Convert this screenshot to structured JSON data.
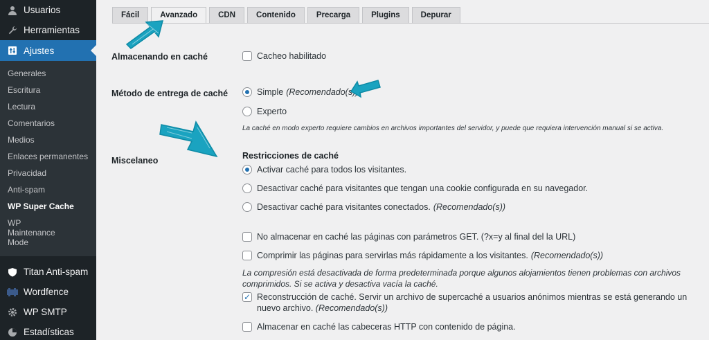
{
  "sidebar": {
    "top_items": [
      {
        "label": "Usuarios",
        "icon": "user-icon"
      },
      {
        "label": "Herramientas",
        "icon": "wrench-icon"
      }
    ],
    "active": {
      "label": "Ajustes",
      "icon": "settings-icon"
    },
    "submenu": [
      "Generales",
      "Escritura",
      "Lectura",
      "Comentarios",
      "Medios",
      "Enlaces permanentes",
      "Privacidad",
      "Anti-spam",
      "WP Super Cache",
      "WP Maintenance Mode"
    ],
    "bottom_items": [
      {
        "label": "Titan Anti-spam",
        "icon": "shield-icon"
      },
      {
        "label": "Wordfence",
        "icon": "wordfence-icon"
      },
      {
        "label": "WP SMTP",
        "icon": "gear-icon"
      },
      {
        "label": "Estadísticas",
        "icon": "pie-chart-icon"
      }
    ]
  },
  "tabs": [
    "Fácil",
    "Avanzado",
    "CDN",
    "Contenido",
    "Precarga",
    "Plugins",
    "Depurar"
  ],
  "settings": {
    "caching_label": "Almacenando en caché",
    "caching_option": "Cacheo habilitado",
    "delivery_label": "Método de entrega de caché",
    "delivery_simple": "Simple",
    "delivery_simple_note": "(Recomendado(s))",
    "delivery_expert": "Experto",
    "delivery_help": "La caché en modo experto requiere cambios en archivos importantes del servidor, y puede que requiera intervención manual si se activa.",
    "misc_label": "Miscelaneo",
    "restrictions_title": "Restricciones de caché",
    "restrict_all": "Activar caché para todos los visitantes.",
    "restrict_cookie": "Desactivar caché para visitantes que tengan una cookie configurada en su navegador.",
    "restrict_logged": "Desactivar caché para visitantes conectados.",
    "restrict_logged_note": "(Recomendado(s))",
    "no_get": "No almacenar en caché las páginas con parámetros GET. (?x=y al final del la URL)",
    "compress": "Comprimir las páginas para servirlas más rápidamente a los visitantes.",
    "compress_note": "(Recomendado(s))",
    "compress_help": "La compresión está desactivada de forma predeterminada porque algunos alojamientos tienen problemas con archivos comprimidos. Si se activa y desactiva vacía la caché.",
    "rebuild": "Reconstrucción de caché. Servir un archivo de supercaché a usuarios anónimos mientras se está generando un nuevo archivo.",
    "rebuild_note": "(Recomendado(s))",
    "http_headers": "Almacenar en caché las cabeceras HTTP con contenido de página."
  },
  "colors": {
    "accent": "#2271b1",
    "sidebar_bg": "#1d2327",
    "annotation": "#1aa3c0"
  }
}
